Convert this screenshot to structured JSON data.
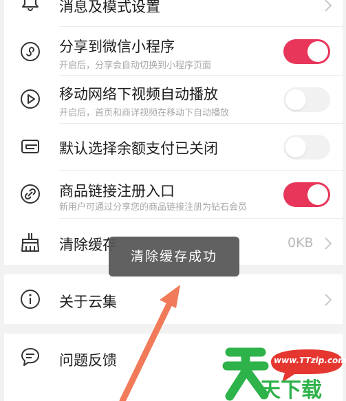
{
  "settings": {
    "notify": {
      "title": "消息及模式设置"
    },
    "share": {
      "title": "分享到微信小程序",
      "subtitle": "开启后，分享会自动切换到小程序页面",
      "enabled": true
    },
    "video": {
      "title": "移动网络下视频自动播放",
      "subtitle": "开启后，首页和商详视频在移动下自动播放",
      "enabled": false
    },
    "balance": {
      "title": "默认选择余额支付已关闭",
      "enabled": false
    },
    "link": {
      "title": "商品链接注册入口",
      "subtitle": "新用户可通过分享您的商品链接注册为钻石会员",
      "enabled": true
    },
    "cache": {
      "title": "清除缓存",
      "value": "0KB"
    },
    "about": {
      "title": "关于云集"
    },
    "feedback": {
      "title": "问题反馈"
    }
  },
  "toast": {
    "message": "清除缓存成功"
  },
  "watermark": {
    "site": "www.TTzip.com",
    "brand_char": "天",
    "brand_text": "天下载"
  },
  "colors": {
    "toggle_on": "#e8365a",
    "toggle_off": "#f1f1f1",
    "annotation_arrow": "#f07a5a",
    "watermark_green": "#2eb24a"
  },
  "icons": {
    "notify": "bell-icon",
    "share": "mini-program-icon",
    "video": "play-circle-icon",
    "balance": "wallet-icon",
    "link": "link-icon",
    "cache": "broom-icon",
    "about": "info-icon",
    "feedback": "chat-bubble-icon",
    "chevron": "chevron-right-icon"
  }
}
